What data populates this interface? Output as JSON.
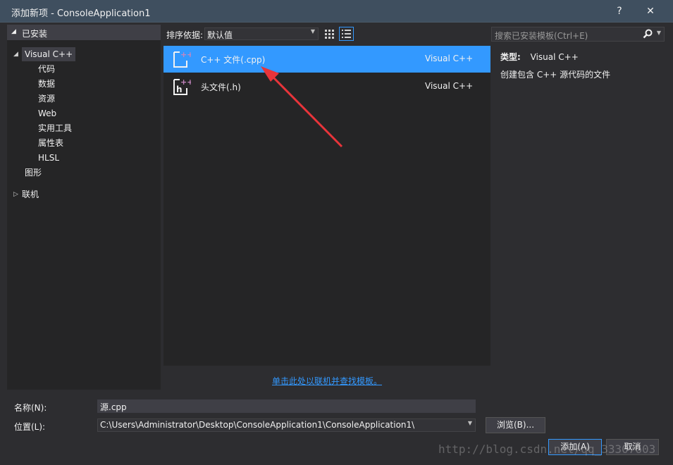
{
  "window": {
    "title": "添加新项 - ConsoleApplication1",
    "help_label": "?",
    "close_label": "✕"
  },
  "left_panel": {
    "header": "已安装",
    "tree": [
      {
        "label": "Visual C++",
        "expanded": true,
        "selected": true
      },
      {
        "label": "代码"
      },
      {
        "label": "数据"
      },
      {
        "label": "资源"
      },
      {
        "label": "Web"
      },
      {
        "label": "实用工具"
      },
      {
        "label": "属性表"
      },
      {
        "label": "HLSL"
      },
      {
        "label": "图形"
      },
      {
        "label": "联机",
        "expanded": false
      }
    ]
  },
  "toolbar": {
    "sort_label": "排序依据:",
    "sort_value": "默认值"
  },
  "search": {
    "placeholder": "搜索已安装模板(Ctrl+E)"
  },
  "templates": [
    {
      "name": "C++ 文件(.cpp)",
      "type": "Visual C++",
      "icon": "cpp-file-icon",
      "selected": true
    },
    {
      "name": "头文件(.h)",
      "type": "Visual C++",
      "icon": "header-file-icon",
      "selected": false
    }
  ],
  "online_link": "单击此处以联机并查找模板。",
  "details": {
    "type_label": "类型:",
    "type_value": "Visual C++",
    "description": "创建包含 C++ 源代码的文件"
  },
  "form": {
    "name_label": "名称(N):",
    "name_value": "源.cpp",
    "location_label": "位置(L):",
    "location_value": "C:\\Users\\Administrator\\Desktop\\ConsoleApplication1\\ConsoleApplication1\\",
    "browse_label": "浏览(B)..."
  },
  "buttons": {
    "add": "添加(A)",
    "cancel": "取消"
  },
  "watermark": "http://blog.csdn.net/qq_33307603",
  "colors": {
    "accent": "#3399ff",
    "background": "#2d2d30",
    "panel": "#252526",
    "titlebar": "#3f4f5f",
    "annotation_arrow": "#e8343a"
  }
}
